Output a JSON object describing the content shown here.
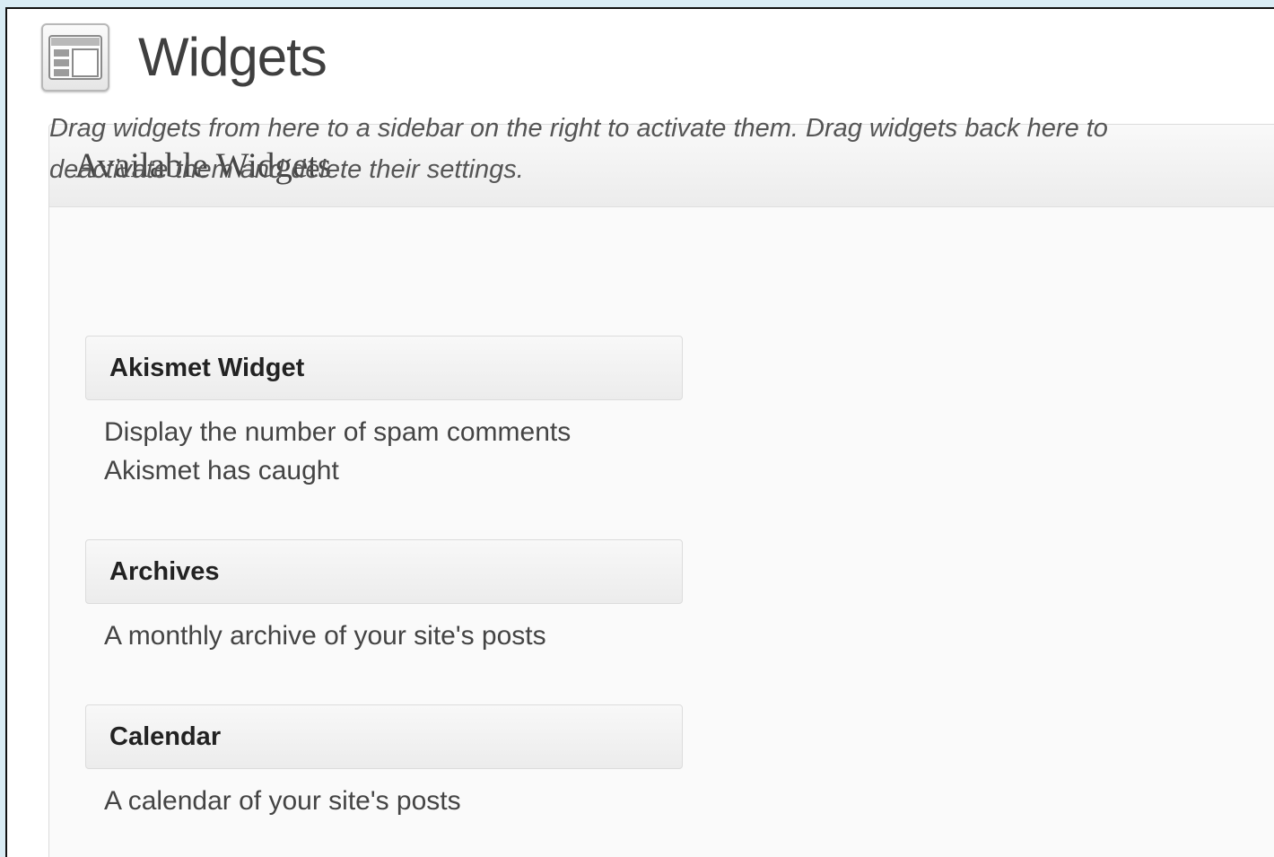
{
  "page": {
    "title": "Widgets",
    "icon": "widgets-layout-icon"
  },
  "available_widgets": {
    "title": "Available Widgets",
    "description": "Drag widgets from here to a sidebar on the right to activate them. Drag widgets back here to deactivate them and delete their settings.",
    "widgets": [
      {
        "title": "Akismet Widget",
        "description": "Display the number of spam comments Akismet has caught"
      },
      {
        "title": "Archives",
        "description": "A monthly archive of your site's posts"
      },
      {
        "title": "Calendar",
        "description": "A calendar of your site's posts"
      }
    ]
  }
}
